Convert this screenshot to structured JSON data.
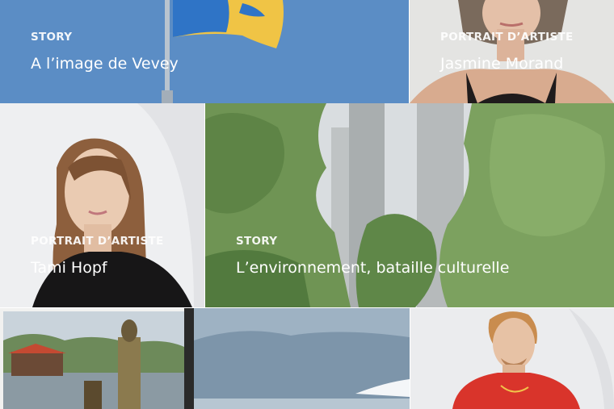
{
  "tiles": [
    {
      "id": "vevey",
      "kicker": "STORY",
      "title": "A l’image de Vevey",
      "bg": "#5a8cc4"
    },
    {
      "id": "jasmine",
      "kicker": "PORTRAIT D’ARTISTE",
      "title": "Jasmine Morand",
      "bg": "#e6e6e4"
    },
    {
      "id": "tami",
      "kicker": "PORTRAIT D’ARTISTE",
      "title": "Tami Hopf",
      "bg": "#ecedef"
    },
    {
      "id": "environnement",
      "kicker": "STORY",
      "title": "L’environnement, bataille culturelle",
      "bg": "#7e9c6b"
    },
    {
      "id": "river",
      "kicker": "",
      "title": "",
      "bg": "#c9d4dc"
    },
    {
      "id": "lake",
      "kicker": "",
      "title": "",
      "bg": "#8fa3b5"
    },
    {
      "id": "man",
      "kicker": "",
      "title": "",
      "bg": "#e9eaec"
    }
  ],
  "colors": {
    "accent": "#ffffff",
    "flag_blue": "#2f76c9",
    "flag_yellow": "#f2c53d",
    "sweater_red": "#d9342b"
  }
}
